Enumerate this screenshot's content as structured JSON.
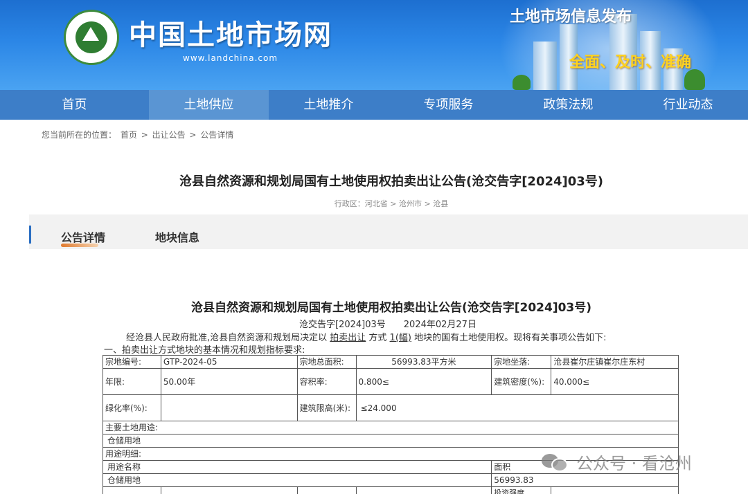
{
  "header": {
    "site_title": "中国土地市场网",
    "site_url": "www.landchina.com",
    "slogan_top": "土地市场信息发布",
    "slogan_bottom": "全面、及时、准确",
    "colors": {
      "banner": "#2b86e6",
      "nav": "#3d7ec8",
      "slogan_accent": "#ffd21f"
    }
  },
  "nav": {
    "items": [
      {
        "label": "首页"
      },
      {
        "label": "土地供应"
      },
      {
        "label": "土地推介"
      },
      {
        "label": "专项服务"
      },
      {
        "label": "政策法规"
      },
      {
        "label": "行业动态"
      }
    ],
    "active": "土地供应"
  },
  "breadcrumb": {
    "prefix": "您当前所在的位置：",
    "items": [
      "首页",
      "出让公告",
      "公告详情"
    ],
    "separator": ">"
  },
  "page": {
    "title": "沧县自然资源和规划局国有土地使用权拍卖出让公告(沧交告字[2024]03号)",
    "region": "行政区：河北省 > 沧州市 > 沧县"
  },
  "tabs": {
    "items": [
      {
        "label": "公告详情"
      },
      {
        "label": "地块信息"
      }
    ],
    "active": "公告详情"
  },
  "content": {
    "title": "沧县自然资源和规划局国有土地使用权拍卖出让公告(沧交告字[2024]03号)",
    "doc_no": "沧交告字[2024]03号",
    "date": "2024年02月27日",
    "para_pre": "经沧县人民政府批准,沧县自然资源和规划局决定以 ",
    "para_method": "拍卖出让",
    "para_mid": " 方式 ",
    "para_count": "1(幅)",
    "para_post": " 地块的国有土地使用权。现将有关事项公告如下:",
    "section_1": "一、拍卖出让方式地块的基本情况和规划指标要求:"
  },
  "table": {
    "r1": [
      "宗地编号:",
      "GTP-2024-05",
      "宗地总面积:",
      "56993.83平方米",
      "宗地坐落:",
      "沧县崔尔庄镇崔尔庄东村"
    ],
    "r2": [
      "年限:",
      "50.00年",
      "容积率:",
      "0.800≤",
      "建筑密度(%):",
      "40.000≤"
    ],
    "r3": [
      "绿化率(%):",
      "",
      "建筑限高(米):",
      "≤24.000"
    ],
    "r4": "主要土地用途:",
    "r5": "仓储用地",
    "r6": "用途明细:",
    "r7": [
      "用途名称",
      "面积"
    ],
    "r8": [
      "仓储用地",
      "56993.83"
    ],
    "r9_partial": "投资强度"
  },
  "watermark": {
    "text": "公众号 · 看沧州",
    "icon": "wechat-icon"
  }
}
